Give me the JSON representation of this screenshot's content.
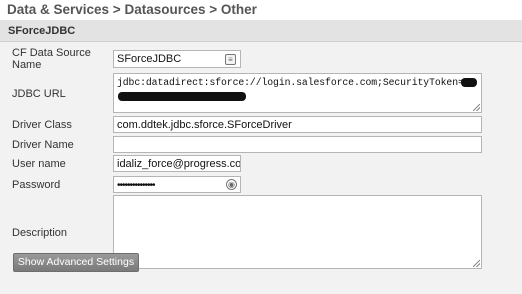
{
  "breadcrumb": "Data & Services > Datasources > Other",
  "panel": {
    "title": "SForceJDBC"
  },
  "form": {
    "cf_data_source_name": {
      "label_line1": "CF Data Source",
      "label_line2": "Name",
      "value": "SForceJDBC"
    },
    "jdbc_url": {
      "label": "JDBC URL",
      "value": "jdbc:datadirect:sforce://login.salesforce.com;SecurityToken="
    },
    "driver_class": {
      "label": "Driver Class",
      "value": "com.ddtek.jdbc.sforce.SForceDriver"
    },
    "driver_name": {
      "label": "Driver Name",
      "value": ""
    },
    "user_name": {
      "label": "User name",
      "value": "idaliz_force@progress.com"
    },
    "password": {
      "label": "Password",
      "value": "•••••••••••••••"
    },
    "description": {
      "label": "Description",
      "value": ""
    }
  },
  "buttons": {
    "show_advanced": "Show Advanced Settings"
  }
}
